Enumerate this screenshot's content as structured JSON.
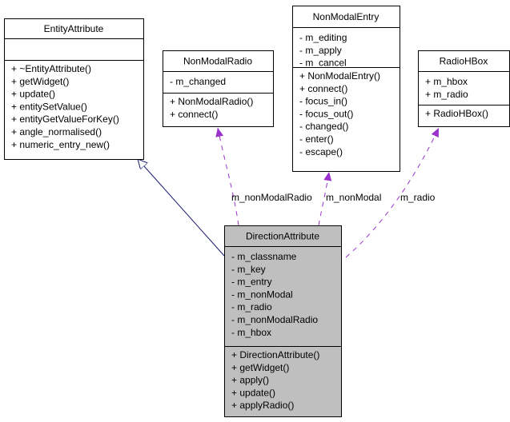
{
  "colors": {
    "highlight_fill": "#bfbfbf",
    "box_fill": "#ffffff",
    "inheritance_edge": "#191970",
    "usage_edge": "#9a32cd"
  },
  "classes": [
    {
      "id": "entity-attribute",
      "name": "EntityAttribute",
      "highlighted": false,
      "attributes": [],
      "methods": [
        "+ ~EntityAttribute()",
        "+ getWidget()",
        "+ update()",
        "+ entitySetValue()",
        "+ entityGetValueForKey()",
        "+ angle_normalised()",
        "+ numeric_entry_new()"
      ]
    },
    {
      "id": "non-modal-radio",
      "name": "NonModalRadio",
      "highlighted": false,
      "attributes": [
        "- m_changed"
      ],
      "methods": [
        "+ NonModalRadio()",
        "+ connect()"
      ]
    },
    {
      "id": "non-modal-entry",
      "name": "NonModalEntry",
      "highlighted": false,
      "attributes": [
        "- m_editing",
        "- m_apply",
        "- m_cancel"
      ],
      "methods": [
        "+ NonModalEntry()",
        "+ connect()",
        "- focus_in()",
        "- focus_out()",
        "- changed()",
        "- enter()",
        "- escape()"
      ]
    },
    {
      "id": "radio-hbox",
      "name": "RadioHBox",
      "highlighted": false,
      "attributes": [
        "+ m_hbox",
        "+ m_radio"
      ],
      "methods": [
        "+ RadioHBox()"
      ]
    },
    {
      "id": "direction-attribute",
      "name": "DirectionAttribute",
      "highlighted": true,
      "attributes": [
        "- m_classname",
        "- m_key",
        "- m_entry",
        "- m_nonModal",
        "- m_radio",
        "- m_nonModalRadio",
        "- m_hbox"
      ],
      "methods": [
        "+ DirectionAttribute()",
        "+ getWidget()",
        "+ apply()",
        "+ update()",
        "+ applyRadio()"
      ]
    }
  ],
  "relations": [
    {
      "type": "inheritance",
      "from": "DirectionAttribute",
      "to": "EntityAttribute",
      "label": ""
    },
    {
      "type": "usage",
      "from": "DirectionAttribute",
      "to": "NonModalRadio",
      "label": "m_nonModalRadio"
    },
    {
      "type": "usage",
      "from": "DirectionAttribute",
      "to": "NonModalEntry",
      "label": "m_nonModal"
    },
    {
      "type": "usage",
      "from": "DirectionAttribute",
      "to": "RadioHBox",
      "label": "m_radio"
    }
  ]
}
